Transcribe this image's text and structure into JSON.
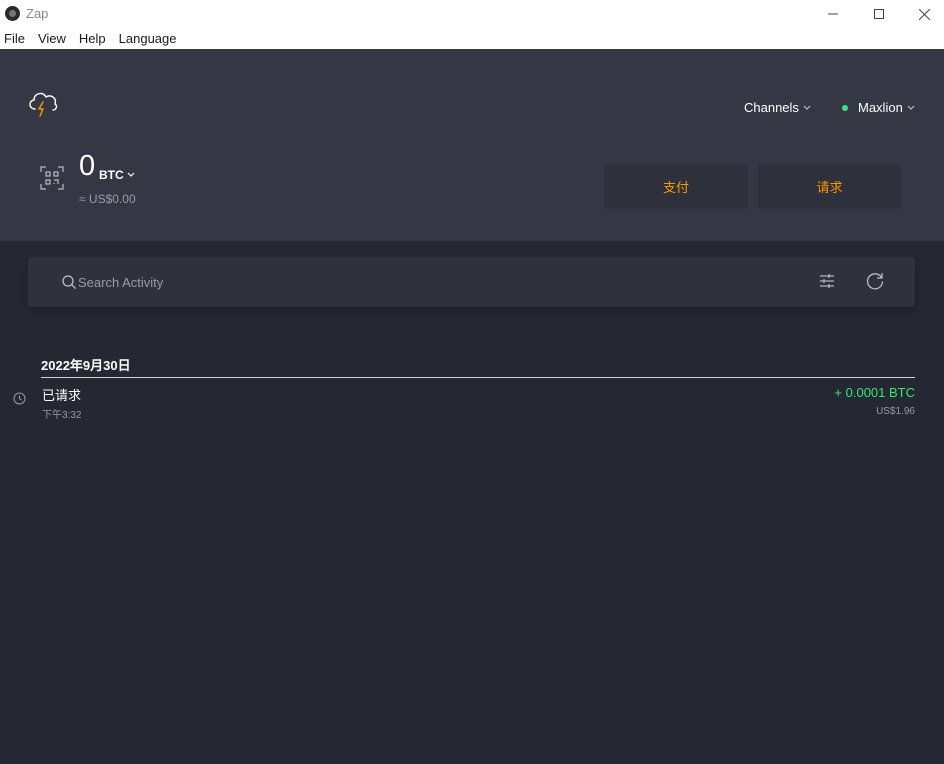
{
  "window": {
    "title": "Zap"
  },
  "menu": [
    "File",
    "View",
    "Help",
    "Language"
  ],
  "header": {
    "channels_label": "Channels",
    "wallet_name": "Maxlion"
  },
  "balance": {
    "amount": "0",
    "unit": "BTC",
    "fiat": "≈ US$0.00"
  },
  "actions": {
    "pay": "支付",
    "request": "请求"
  },
  "search": {
    "placeholder": "Search Activity"
  },
  "activity": {
    "groups": [
      {
        "date": "2022年9月30日",
        "items": [
          {
            "title": "已请求",
            "time": "下午3:32",
            "amount": "+ 0.0001 BTC",
            "fiat": "US$1.96"
          }
        ]
      }
    ]
  },
  "colors": {
    "accent": "#fd9800",
    "positive": "#39e673",
    "header_bg": "#353745",
    "body_bg": "#252733"
  }
}
